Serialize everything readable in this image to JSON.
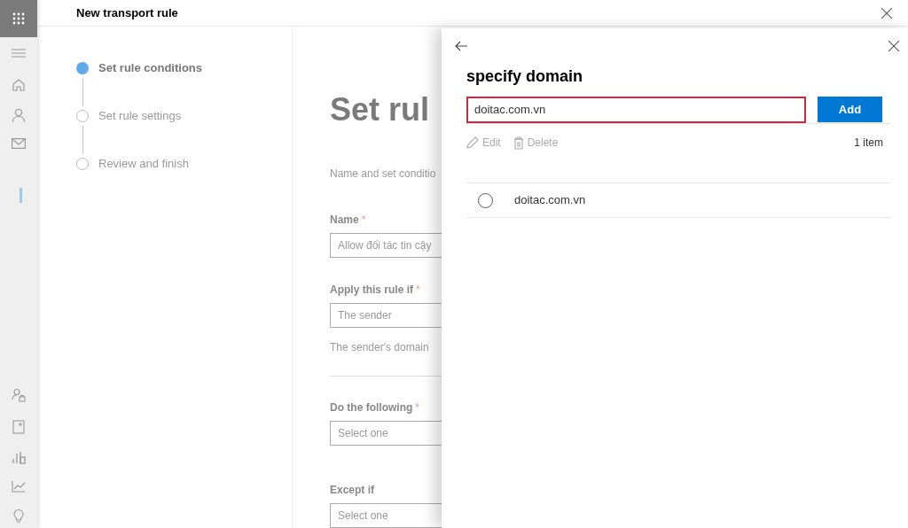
{
  "header": {
    "title": "New transport rule"
  },
  "steps": [
    {
      "label": "Set rule conditions",
      "selected": true
    },
    {
      "label": "Set rule settings",
      "selected": false
    },
    {
      "label": "Review and finish",
      "selected": false
    }
  ],
  "content": {
    "heading": "Set rul",
    "description": "Name and set conditio",
    "fields": [
      {
        "label": "Name",
        "required_mark": "*",
        "value": "Allow đối tác tin cậy"
      },
      {
        "label": "Apply this rule if",
        "required_mark": "*",
        "value": "The sender",
        "note": "The sender's domain"
      },
      {
        "label": "Do the following",
        "required_mark": "*",
        "value": "Select one"
      },
      {
        "label": "Except if",
        "value": "Select one"
      }
    ]
  },
  "panel": {
    "title": "specify domain",
    "input": {
      "value": "doitac.com.vn",
      "invalid": true
    },
    "add_button": "Add",
    "toolbar": [
      {
        "kind": "edit",
        "label": "Edit",
        "disabled": true
      },
      {
        "kind": "delete",
        "label": "Delete",
        "disabled": true
      }
    ],
    "count": "1 item",
    "items": [
      {
        "label": "doitac.com.vn",
        "selected": false
      }
    ]
  }
}
